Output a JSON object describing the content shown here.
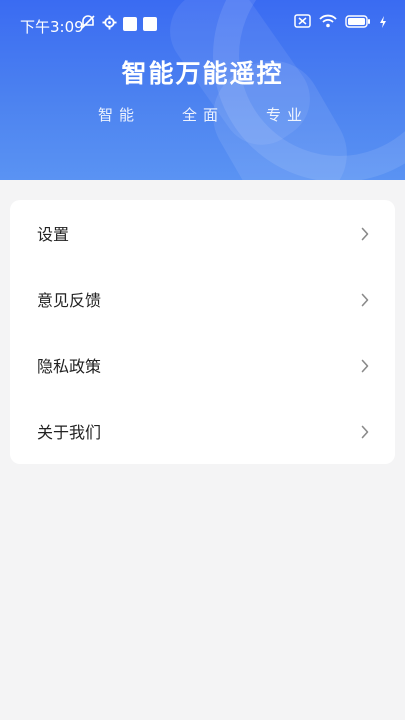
{
  "status_bar": {
    "time": "下午3:09",
    "icons": [
      "alarm-off-icon",
      "settings-icon",
      "notification-icon",
      "notification-icon",
      "sim-off-icon",
      "wifi-icon",
      "battery-icon",
      "charging-icon"
    ]
  },
  "header": {
    "title": "智能万能遥控",
    "tags": [
      "智能",
      "全面",
      "专业"
    ]
  },
  "menu": {
    "items": [
      {
        "label": "设置",
        "icon": "chevron-right-icon"
      },
      {
        "label": "意见反馈",
        "icon": "chevron-right-icon"
      },
      {
        "label": "隐私政策",
        "icon": "chevron-right-icon"
      },
      {
        "label": "关于我们",
        "icon": "chevron-right-icon"
      }
    ]
  },
  "colors": {
    "header_gradient_top": "#3a6bf2",
    "header_gradient_bottom": "#5a93f3",
    "page_background": "#f4f4f5",
    "card_background": "#ffffff",
    "chevron": "#8a8a8a"
  }
}
